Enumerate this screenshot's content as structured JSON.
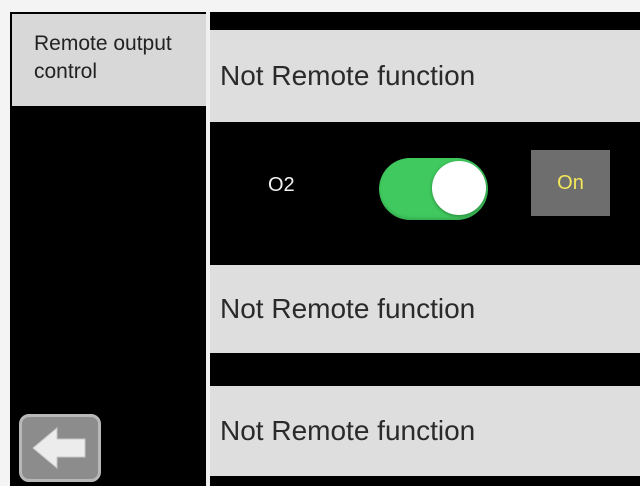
{
  "sidebar": {
    "title": "Remote output\ncontrol"
  },
  "rows": [
    {
      "label": "Not Remote function"
    },
    {
      "output_name": "O2",
      "toggle_state": "on",
      "status_label": "On"
    },
    {
      "label": "Not Remote function"
    },
    {
      "label": "Not Remote function"
    }
  ],
  "icons": {
    "back": "arrow-left-icon"
  },
  "colors": {
    "toggle_on": "#3fc95e",
    "status_text": "#f4e85a",
    "row_background": "#dedede",
    "sidebar_title_background": "#d8d8d8"
  }
}
